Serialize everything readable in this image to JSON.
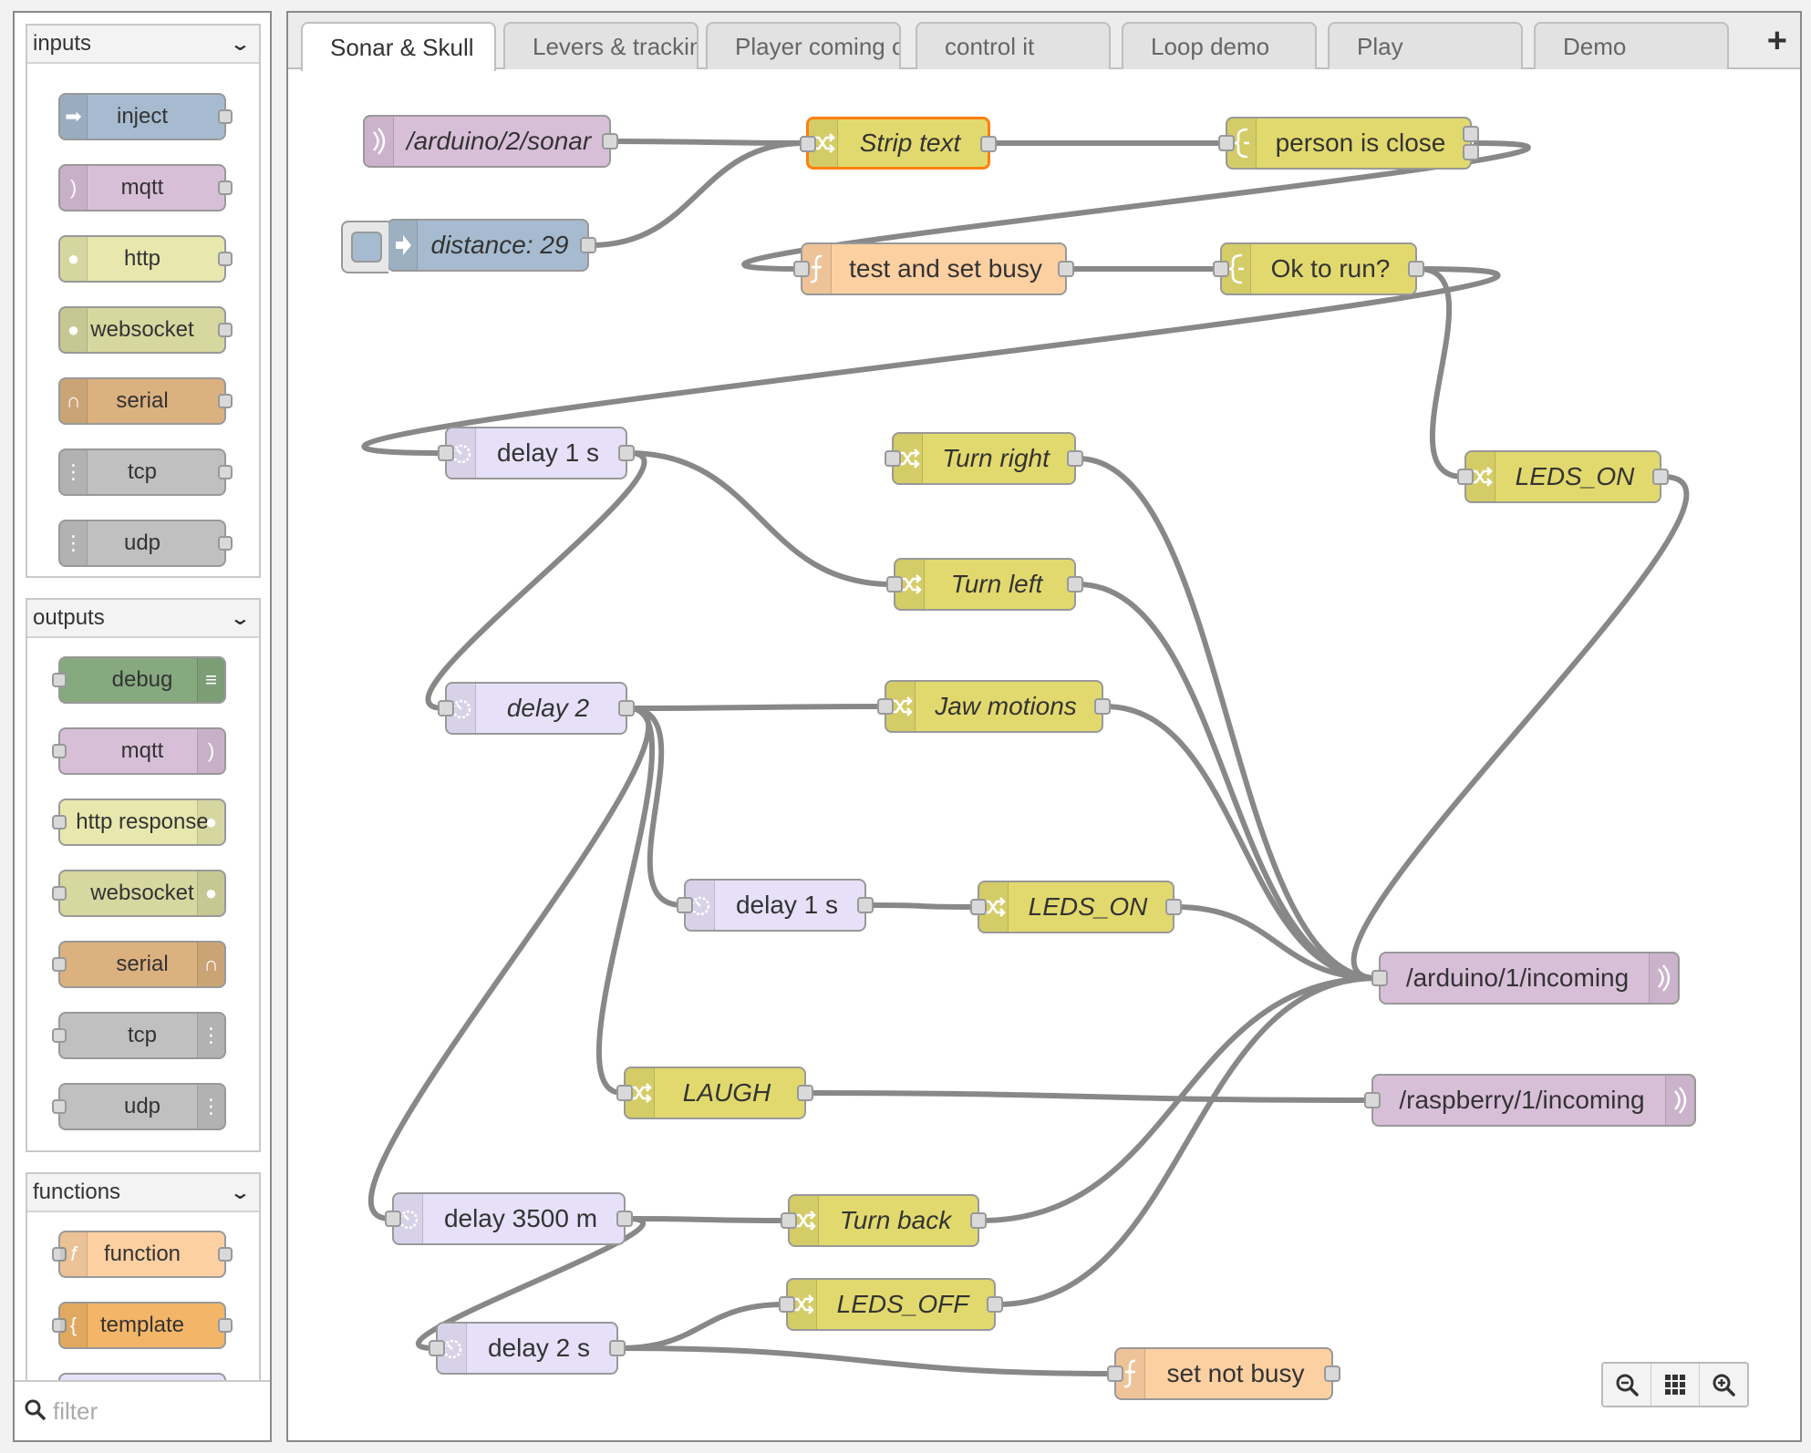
{
  "palette": {
    "categories": [
      {
        "name": "inputs",
        "nodes": [
          {
            "label": "inject",
            "icon": "inject-icon"
          },
          {
            "label": "mqtt",
            "icon": "bridge-icon"
          },
          {
            "label": "http",
            "icon": "white-globe-icon"
          },
          {
            "label": "websocket",
            "icon": "white-globe-icon"
          },
          {
            "label": "serial",
            "icon": "serial-icon"
          },
          {
            "label": "tcp",
            "icon": "bridge-dash-icon"
          },
          {
            "label": "udp",
            "icon": "bridge-dash-icon"
          }
        ]
      },
      {
        "name": "outputs",
        "nodes": [
          {
            "label": "debug",
            "icon": "debug-icon"
          },
          {
            "label": "mqtt",
            "icon": "bridge-icon"
          },
          {
            "label": "http response",
            "icon": "white-globe-icon"
          },
          {
            "label": "websocket",
            "icon": "white-globe-icon"
          },
          {
            "label": "serial",
            "icon": "serial-icon"
          },
          {
            "label": "tcp",
            "icon": "bridge-dash-icon"
          },
          {
            "label": "udp",
            "icon": "bridge-dash-icon"
          }
        ]
      },
      {
        "name": "functions",
        "nodes": [
          {
            "label": "function",
            "icon": "function-icon"
          },
          {
            "label": "template",
            "icon": "template-icon"
          }
        ]
      }
    ],
    "filter_placeholder": "filter"
  },
  "tabs": [
    "Sonar & Skull",
    "Levers & tracking",
    "Player coming c",
    "control it",
    "Loop demo",
    "Play",
    "Demo"
  ],
  "active_tab": "Sonar & Skull",
  "colors": {
    "mqtt": "#d8bfd8",
    "inject": "#a6bbcf",
    "http": "#e7e7ae",
    "websocket": "#d7d7a0",
    "serial": "#dbb17f",
    "tcp": "#c0c0c0",
    "debug": "#87a980",
    "function": "#fdd0a2",
    "template": "#f3b567",
    "change": "#e2d96e",
    "switch": "#e2d96e",
    "delay": "#e6e0f8",
    "selected": "#ff7f0e"
  },
  "flow": {
    "nodes": [
      {
        "id": "n1",
        "label": "/arduino/2/sonar",
        "type": "mqtt",
        "italic": true
      },
      {
        "id": "n2",
        "label": "distance: 29",
        "type": "inject",
        "italic": true
      },
      {
        "id": "n3",
        "label": "Strip text",
        "type": "change",
        "italic": true,
        "selected": true
      },
      {
        "id": "n4",
        "label": "person is close",
        "type": "switch",
        "italic": false
      },
      {
        "id": "n5",
        "label": "test and set busy",
        "type": "function",
        "italic": false
      },
      {
        "id": "n6",
        "label": "Ok to run?",
        "type": "switch",
        "italic": false
      },
      {
        "id": "n7",
        "label": "delay 1 s",
        "type": "delay",
        "italic": false
      },
      {
        "id": "n8",
        "label": "Turn right",
        "type": "change",
        "italic": true
      },
      {
        "id": "n9",
        "label": "LEDS_ON",
        "type": "change",
        "italic": true
      },
      {
        "id": "n10",
        "label": "Turn left",
        "type": "change",
        "italic": true
      },
      {
        "id": "n11",
        "label": "delay 2",
        "type": "delay",
        "italic": true
      },
      {
        "id": "n12",
        "label": "Jaw motions",
        "type": "change",
        "italic": true
      },
      {
        "id": "n13",
        "label": "delay 1 s",
        "type": "delay",
        "italic": false
      },
      {
        "id": "n14",
        "label": "LEDS_ON",
        "type": "change",
        "italic": true
      },
      {
        "id": "n15",
        "label": "/arduino/1/incoming",
        "type": "mqtt",
        "italic": false
      },
      {
        "id": "n16",
        "label": "LAUGH",
        "type": "change",
        "italic": true
      },
      {
        "id": "n17",
        "label": "/raspberry/1/incoming",
        "type": "mqtt",
        "italic": false
      },
      {
        "id": "n18",
        "label": "delay 3500 m",
        "type": "delay",
        "italic": false
      },
      {
        "id": "n19",
        "label": "Turn back",
        "type": "change",
        "italic": true
      },
      {
        "id": "n20",
        "label": "LEDS_OFF",
        "type": "change",
        "italic": true
      },
      {
        "id": "n21",
        "label": "delay 2 s",
        "type": "delay",
        "italic": false
      },
      {
        "id": "n22",
        "label": "set not busy",
        "type": "function",
        "italic": false
      }
    ],
    "wires": [
      [
        "n1",
        "n3"
      ],
      [
        "n2",
        "n3"
      ],
      [
        "n3",
        "n4"
      ],
      [
        "n4",
        "n5"
      ],
      [
        "n5",
        "n6"
      ],
      [
        "n6",
        "n7"
      ],
      [
        "n6",
        "n9"
      ],
      [
        "n7",
        "n10"
      ],
      [
        "n7",
        "n11"
      ],
      [
        "n11",
        "n12"
      ],
      [
        "n11",
        "n13"
      ],
      [
        "n11",
        "n16"
      ],
      [
        "n11",
        "n18"
      ],
      [
        "n13",
        "n14"
      ],
      [
        "n16",
        "n17"
      ],
      [
        "n18",
        "n19"
      ],
      [
        "n18",
        "n21"
      ],
      [
        "n21",
        "n20"
      ],
      [
        "n21",
        "n22"
      ],
      [
        "n8",
        "n15"
      ],
      [
        "n9",
        "n15"
      ],
      [
        "n10",
        "n15"
      ],
      [
        "n12",
        "n15"
      ],
      [
        "n14",
        "n15"
      ],
      [
        "n19",
        "n15"
      ],
      [
        "n20",
        "n15"
      ]
    ]
  },
  "zoom_controls": [
    "zoom-out-icon",
    "zoom-reset-icon",
    "zoom-in-icon"
  ]
}
